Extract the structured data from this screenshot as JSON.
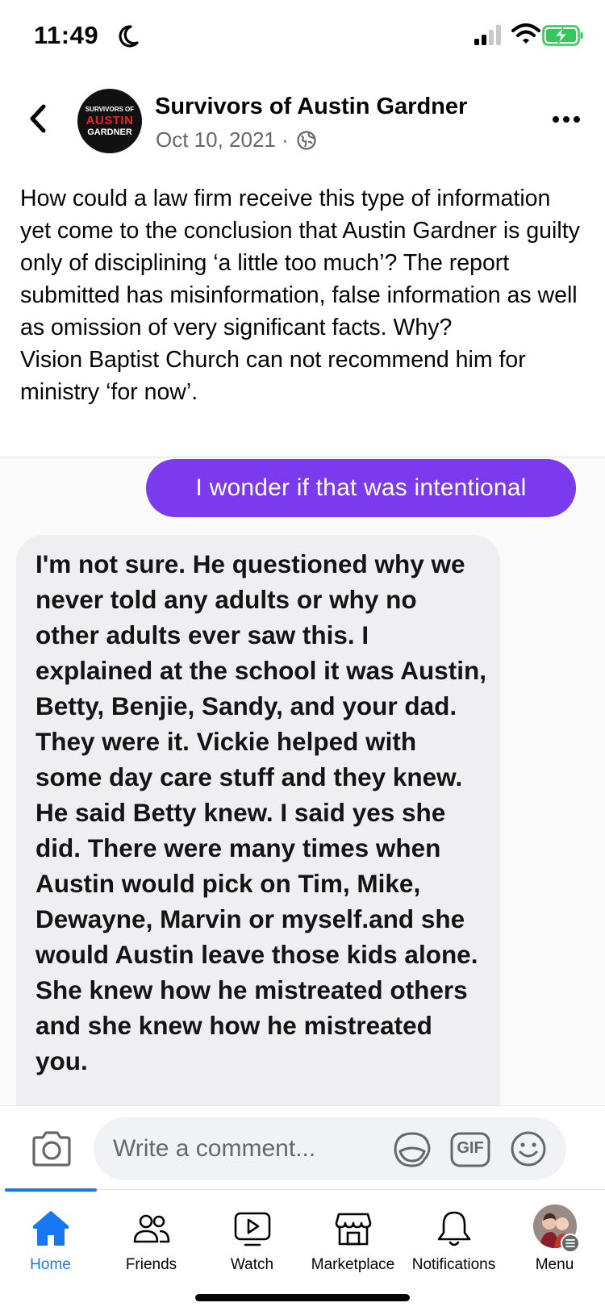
{
  "status": {
    "time": "11:49"
  },
  "post": {
    "page_name": "Survivors of Austin Gardner",
    "avatar_text": {
      "line1": "SURVIVORS OF",
      "line2": "AUSTIN",
      "line3": "GARDNER"
    },
    "date": "Oct 10, 2021 ·",
    "body_lines": [
      "How could a law firm receive this type of information yet come to the conclusion that Austin Gardner is guilty only of disciplining ‘a little too much’? The report submitted has misinformation, false information as well as omission of very significant facts. Why?",
      "Vision Baptist Church can not recommend him for ministry ‘for now’."
    ]
  },
  "screenshot": {
    "sent_message": "I wonder if that was intentional",
    "received_message": "I'm not sure. He questioned why we never told any adults or why no other adults ever saw this. I explained at the school it was Austin, Betty, Benjie, Sandy, and your dad. They were it. Vickie helped with some day care stuff and they knew. He said Betty knew. I said yes she did. There were many times when Austin would pick on Tim, Mike, Dewayne, Marvin or myself.and she would Austin leave those kids alone. She knew how he mistreated others and she knew how he mistreated you."
  },
  "comment": {
    "placeholder": "Write a comment...",
    "gif_label": "GIF"
  },
  "tabs": [
    {
      "label": "Home",
      "icon": "home-icon",
      "active": true
    },
    {
      "label": "Friends",
      "icon": "friends-icon"
    },
    {
      "label": "Watch",
      "icon": "watch-icon"
    },
    {
      "label": "Marketplace",
      "icon": "marketplace-icon"
    },
    {
      "label": "Notifications",
      "icon": "bell-icon"
    },
    {
      "label": "Menu",
      "icon": "menu-avatar"
    }
  ],
  "colors": {
    "accent": "#1877f2",
    "sent_bubble": "#7b3aed",
    "battery": "#34c759"
  }
}
